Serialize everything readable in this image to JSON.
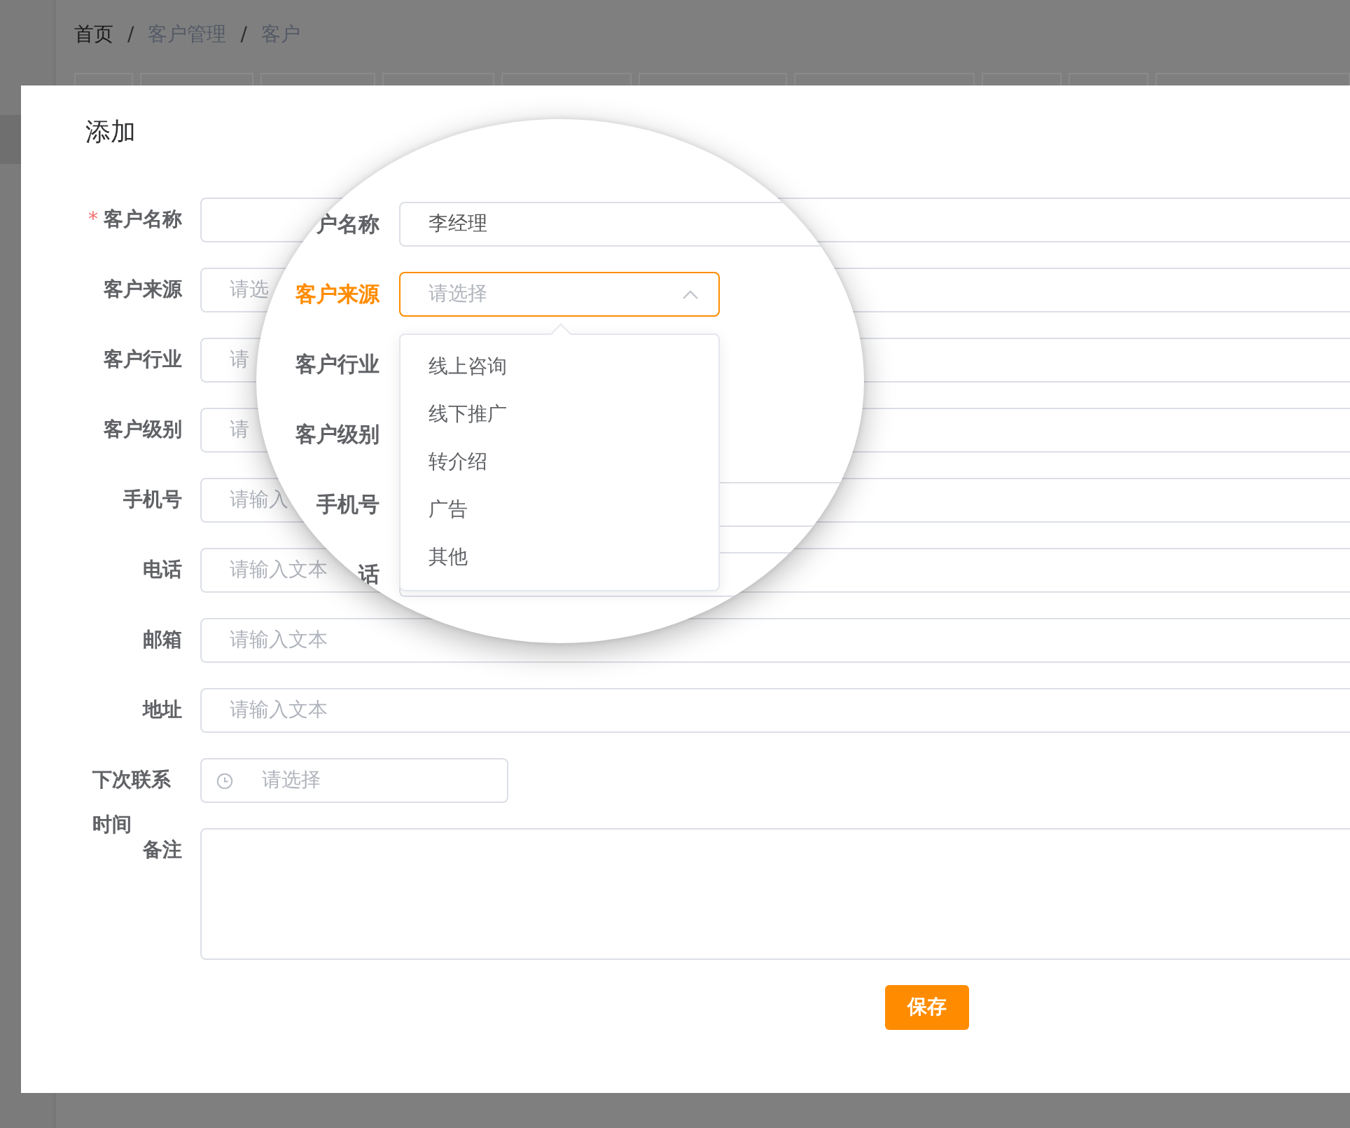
{
  "breadcrumb": {
    "separator": "/",
    "items": [
      {
        "label": "首页",
        "link": true
      },
      {
        "label": "客户管理",
        "link": false
      },
      {
        "label": "客户",
        "link": false
      }
    ]
  },
  "dialog": {
    "title": "添加",
    "fields": [
      {
        "label": "客户名称",
        "required_mark": "*",
        "kind": "input"
      },
      {
        "label": "客户来源",
        "kind": "select",
        "placeholder": "请选"
      },
      {
        "label": "客户行业",
        "kind": "select",
        "placeholder": "请"
      },
      {
        "label": "客户级别",
        "kind": "select",
        "placeholder": "请"
      },
      {
        "label": "手机号",
        "kind": "input",
        "placeholder": "请输入"
      },
      {
        "label": "电话",
        "kind": "input",
        "placeholder": "请输入文本"
      },
      {
        "label": "邮箱",
        "kind": "input",
        "placeholder": "请输入文本"
      },
      {
        "label": "地址",
        "kind": "input",
        "placeholder": "请输入文本"
      },
      {
        "label": "下次联系时间",
        "kind": "date",
        "placeholder": "请选择"
      },
      {
        "label": "备注",
        "kind": "textarea"
      }
    ],
    "save_button": "保存"
  },
  "magnifier": {
    "fields": [
      {
        "label": "户名称",
        "kind": "input",
        "value": "李经理",
        "focused": false
      },
      {
        "label": "客户来源",
        "kind": "select",
        "placeholder": "请选择",
        "focused": true
      },
      {
        "label": "客户行业",
        "kind": "label",
        "focused": false
      },
      {
        "label": "客户级别",
        "kind": "label",
        "focused": false
      },
      {
        "label": "手机号",
        "kind": "input",
        "focused": false
      },
      {
        "label": "话",
        "kind": "input",
        "focused": false
      }
    ],
    "dropdown": {
      "options": [
        "线上咨询",
        "线下推广",
        "转介绍",
        "广告",
        "其他"
      ]
    }
  }
}
